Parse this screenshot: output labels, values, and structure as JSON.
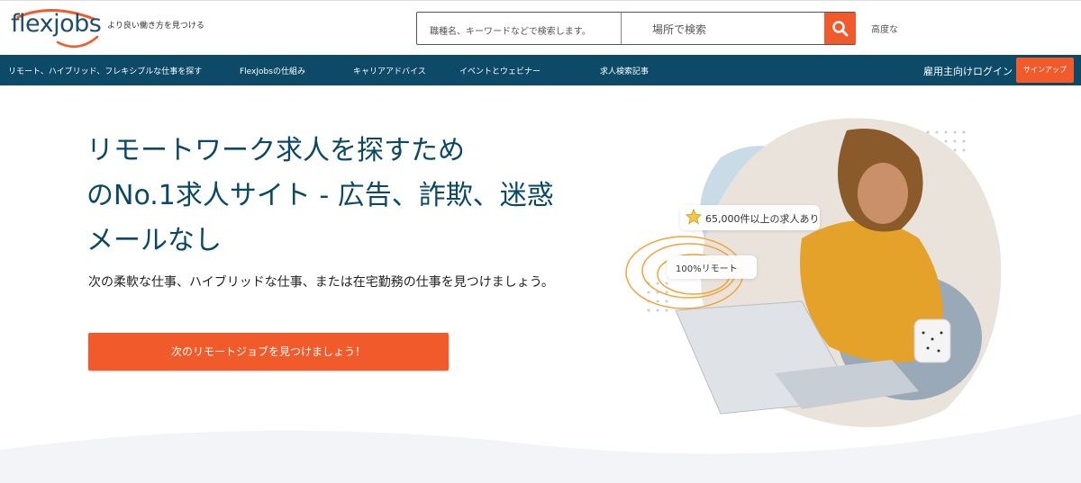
{
  "header": {
    "logo_text": "flexjobs",
    "tagline": "より良い働き方を見つける",
    "search": {
      "keyword_placeholder": "職種名、キーワードなどで検索します。",
      "location_placeholder": "場所で検索"
    },
    "advanced_label": "高度な"
  },
  "nav": {
    "items": [
      {
        "label": "リモート、ハイブリッド、フレキシブルな仕事を探す"
      },
      {
        "label": "FlexJobsの仕組み"
      },
      {
        "label": "キャリアアドバイス"
      },
      {
        "label": "イベントとウェビナー"
      },
      {
        "label": "求人検索記事"
      }
    ],
    "employer_login": "雇用主向けログイン",
    "signup": "サインアップ"
  },
  "hero": {
    "title_lines": [
      "リモートワーク求人を探すため",
      " のNo.1求人サイト - 広告、詐欺、迷惑",
      "メールなし"
    ],
    "subtitle": "次の柔軟な仕事、ハイブリッドな仕事、または在宅勤務の仕事を見つけましょう。",
    "cta": "次のリモートジョブを見つけましょう！",
    "badge_jobs": "65,000件以上の求人あり",
    "badge_remote": "100%リモート"
  },
  "colors": {
    "brand": "#f15a2b",
    "navy": "#0c4a68"
  },
  "icons": {
    "search": "search-icon",
    "star": "star-icon"
  }
}
